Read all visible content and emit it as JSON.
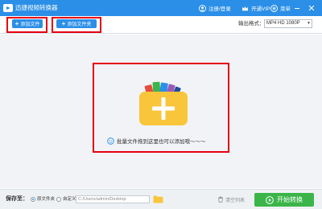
{
  "app": {
    "title": "迅捷视频转换器"
  },
  "titlebar": {
    "register_login": "注册/登录",
    "open_vip": "开通VIP",
    "menu": "菜单",
    "icons": [
      "app-logo-icon",
      "user-icon",
      "vip-crown-icon",
      "menu-icon",
      "minimize-icon",
      "close-icon"
    ]
  },
  "toolbar": {
    "add_file": "添加文件",
    "add_folder": "添加文件夹",
    "output_format_label": "输出格式：",
    "output_format_value": "MP4  HD 1080P"
  },
  "main": {
    "drop_hint": "批量文件拖到这里也可以添加哦～～～"
  },
  "bottom": {
    "save_to_label": "保存至：",
    "option_original": "原文件夹",
    "option_custom": "自定义",
    "selected_option": "original",
    "path_value": "C:/Users/admin/Desktop",
    "clear_list": "清空列表",
    "start_convert": "开始转换"
  },
  "colors": {
    "titlebar": "#2b8fe8",
    "primary_button": "#2b8fe8",
    "highlight_box": "#e60012",
    "folder": "#f9c53a",
    "start_button": "#3bb54a"
  }
}
